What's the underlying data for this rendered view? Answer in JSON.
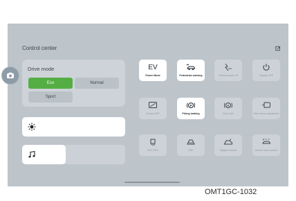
{
  "control_center": {
    "title": "Control center",
    "drive_mode": {
      "label": "Drive mode",
      "options": [
        "Eco",
        "Normal",
        "Sport"
      ],
      "selected": "Eco"
    },
    "brightness": {
      "icon": "brightness-icon",
      "level": 1.0
    },
    "volume": {
      "icon": "music-note-icon",
      "level": 0.42
    },
    "tiles": [
      {
        "label": "Power Mode",
        "active": true,
        "icon": "ev-text"
      },
      {
        "label": "Pedestrian warning",
        "active": true,
        "icon": "pedestrian-warning-icon"
      },
      {
        "label": "Vehicle power off",
        "active": false,
        "icon": "vehicle-power-off-icon"
      },
      {
        "label": "Display OFF",
        "active": false,
        "icon": "power-icon"
      },
      {
        "label": "Screen OFF",
        "active": false,
        "icon": "screen-off-icon"
      },
      {
        "label": "Prking braking",
        "active": true,
        "icon": "parking-brake-icon"
      },
      {
        "label": "Auto hold",
        "active": false,
        "icon": "auto-hold-icon"
      },
      {
        "label": "Rear mirror adjustment",
        "active": false,
        "icon": "rear-mirror-icon"
      },
      {
        "label": "ESC OFF",
        "active": false,
        "icon": "esc-off-icon"
      },
      {
        "label": "HDC",
        "active": false,
        "icon": "hdc-icon"
      },
      {
        "label": "Tailgate Intrame",
        "active": false,
        "icon": "tailgate-icon"
      },
      {
        "label": "Around view monitor",
        "active": false,
        "icon": "around-view-icon"
      }
    ],
    "ev_text": "EV"
  },
  "colors": {
    "accent": "#55ae43",
    "screen": "#bdc5cb",
    "card": "#cdd3d8"
  },
  "caption": "OMT1GC-1032"
}
